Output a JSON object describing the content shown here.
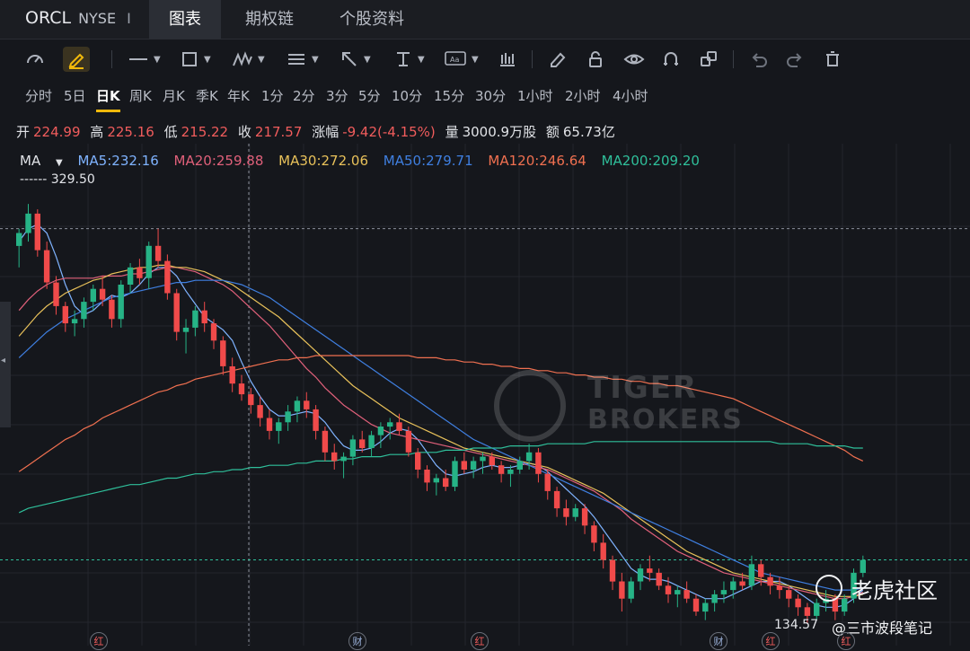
{
  "header": {
    "symbol": "ORCL",
    "exchange": "NYSE",
    "separator": "I",
    "tabs": [
      "图表",
      "期权链",
      "个股资料"
    ]
  },
  "toolbar": {
    "icons": [
      "gauge-icon",
      "pencil-highlight-icon",
      "line-icon",
      "rectangle-icon",
      "wave-icon",
      "text-lines-icon",
      "arrow-icon",
      "text-cursor-icon",
      "aa-label-icon",
      "bars-icon",
      "eraser-icon",
      "lock-icon",
      "eye-icon",
      "magnet-icon",
      "layers-icon",
      "undo-icon",
      "redo-icon",
      "trash-icon"
    ]
  },
  "periods": [
    "分时",
    "5日",
    "日K",
    "周K",
    "月K",
    "季K",
    "年K",
    "1分",
    "2分",
    "3分",
    "5分",
    "10分",
    "15分",
    "30分",
    "1小时",
    "2小时",
    "4小时"
  ],
  "active_period": "日K",
  "quote": {
    "open_label": "开",
    "open": "224.99",
    "high_label": "高",
    "high": "225.16",
    "low_label": "低",
    "low": "215.22",
    "close_label": "收",
    "close": "217.57",
    "change_label": "涨幅",
    "change": "-9.42(-4.15%)",
    "volume_label": "量",
    "volume": "3000.9万股",
    "amount_label": "额",
    "amount": "65.73亿"
  },
  "ma_legend": {
    "title": "MA",
    "items": [
      {
        "text": "MA5:232.16",
        "color": "#7fb3ff"
      },
      {
        "text": "MA20:259.88",
        "color": "#e0607a"
      },
      {
        "text": "MA30:272.06",
        "color": "#e8c15a"
      },
      {
        "text": "MA50:279.71",
        "color": "#3f7fe0"
      },
      {
        "text": "MA120:246.64",
        "color": "#f07050"
      },
      {
        "text": "MA200:209.20",
        "color": "#2fbf9a"
      }
    ]
  },
  "chart_data": {
    "type": "candlestick",
    "high_marker": "329.50",
    "low_marker": "134.57",
    "ylim": [
      130,
      345
    ],
    "up_color": "#26b386",
    "down_color": "#f04a4a",
    "candles": [
      [
        310,
        318,
        300,
        316
      ],
      [
        316,
        329.5,
        312,
        325
      ],
      [
        325,
        327,
        305,
        308
      ],
      [
        308,
        312,
        290,
        293
      ],
      [
        293,
        296,
        278,
        282
      ],
      [
        282,
        284,
        270,
        274
      ],
      [
        274,
        280,
        268,
        276
      ],
      [
        276,
        286,
        272,
        284
      ],
      [
        284,
        292,
        280,
        290
      ],
      [
        290,
        296,
        282,
        285
      ],
      [
        285,
        287,
        272,
        276
      ],
      [
        276,
        294,
        272,
        292
      ],
      [
        292,
        302,
        288,
        300
      ],
      [
        300,
        304,
        292,
        295
      ],
      [
        295,
        312,
        290,
        310
      ],
      [
        310,
        318,
        300,
        303
      ],
      [
        303,
        306,
        285,
        288
      ],
      [
        288,
        290,
        266,
        270
      ],
      [
        270,
        276,
        260,
        272
      ],
      [
        272,
        282,
        268,
        280
      ],
      [
        280,
        284,
        270,
        274
      ],
      [
        274,
        276,
        262,
        266
      ],
      [
        266,
        268,
        250,
        254
      ],
      [
        254,
        258,
        242,
        246
      ],
      [
        246,
        250,
        238,
        241
      ],
      [
        241,
        244,
        232,
        236
      ],
      [
        236,
        240,
        226,
        230
      ],
      [
        230,
        234,
        220,
        224
      ],
      [
        224,
        230,
        218,
        228
      ],
      [
        228,
        236,
        224,
        233
      ],
      [
        233,
        240,
        228,
        238
      ],
      [
        238,
        242,
        230,
        234
      ],
      [
        234,
        236,
        220,
        224
      ],
      [
        224,
        226,
        210,
        214
      ],
      [
        214,
        218,
        206,
        210
      ],
      [
        210,
        214,
        202,
        212
      ],
      [
        212,
        222,
        208,
        220
      ],
      [
        220,
        224,
        214,
        216
      ],
      [
        216,
        224,
        212,
        222
      ],
      [
        222,
        228,
        216,
        226
      ],
      [
        226,
        230,
        220,
        228
      ],
      [
        228,
        232,
        222,
        224
      ],
      [
        224,
        226,
        212,
        214
      ],
      [
        214,
        216,
        202,
        206
      ],
      [
        206,
        208,
        196,
        200
      ],
      [
        200,
        204,
        194,
        202
      ],
      [
        202,
        206,
        196,
        198
      ],
      [
        198,
        212,
        196,
        210
      ],
      [
        210,
        214,
        204,
        206
      ],
      [
        206,
        212,
        202,
        210
      ],
      [
        210,
        214,
        204,
        212
      ],
      [
        212,
        214,
        206,
        208
      ],
      [
        208,
        210,
        200,
        204
      ],
      [
        204,
        208,
        198,
        206
      ],
      [
        206,
        212,
        204,
        210
      ],
      [
        210,
        218,
        206,
        214
      ],
      [
        214,
        216,
        200,
        204
      ],
      [
        204,
        206,
        192,
        196
      ],
      [
        196,
        198,
        184,
        188
      ],
      [
        188,
        192,
        180,
        184
      ],
      [
        184,
        190,
        182,
        188
      ],
      [
        188,
        190,
        176,
        180
      ],
      [
        180,
        182,
        168,
        172
      ],
      [
        172,
        176,
        160,
        164
      ],
      [
        164,
        166,
        150,
        154
      ],
      [
        154,
        158,
        140,
        146
      ],
      [
        146,
        156,
        144,
        154
      ],
      [
        154,
        162,
        150,
        160
      ],
      [
        160,
        166,
        154,
        158
      ],
      [
        158,
        160,
        150,
        152
      ],
      [
        152,
        156,
        144,
        148
      ],
      [
        148,
        152,
        142,
        150
      ],
      [
        150,
        154,
        144,
        146
      ],
      [
        146,
        148,
        138,
        140
      ],
      [
        140,
        146,
        136,
        144
      ],
      [
        144,
        150,
        140,
        148
      ],
      [
        148,
        154,
        144,
        150
      ],
      [
        150,
        156,
        146,
        154
      ],
      [
        154,
        158,
        150,
        152
      ],
      [
        152,
        166,
        150,
        162
      ],
      [
        162,
        164,
        152,
        156
      ],
      [
        156,
        158,
        148,
        152
      ],
      [
        152,
        156,
        146,
        150
      ],
      [
        150,
        152,
        142,
        146
      ],
      [
        146,
        148,
        138,
        142
      ],
      [
        142,
        144,
        134.57,
        138
      ],
      [
        138,
        146,
        136,
        144
      ],
      [
        144,
        150,
        140,
        146
      ],
      [
        146,
        148,
        136,
        140
      ],
      [
        140,
        148,
        138,
        146
      ],
      [
        146,
        160,
        144,
        158
      ],
      [
        158,
        166,
        156,
        164
      ]
    ],
    "series": [
      {
        "name": "MA5",
        "color": "#7fb3ff",
        "values": [
          312,
          318,
          320,
          316,
          305,
          292,
          282,
          278,
          280,
          284,
          287,
          286,
          288,
          292,
          297,
          300,
          300,
          296,
          289,
          283,
          277,
          274,
          271,
          266,
          256,
          247,
          240,
          234,
          231,
          231,
          232,
          233,
          232,
          228,
          222,
          217,
          215,
          215,
          216,
          219,
          223,
          225,
          224,
          220,
          214,
          208,
          204,
          203,
          204,
          205,
          207,
          208,
          207,
          207,
          208,
          209,
          208,
          205,
          201,
          197,
          193,
          189,
          184,
          178,
          172,
          166,
          160,
          157,
          155,
          155,
          154,
          152,
          150,
          148,
          146,
          146,
          146,
          148,
          150,
          152,
          154,
          154,
          154,
          152,
          149,
          146,
          143,
          142,
          142,
          143,
          146,
          150
        ]
      },
      {
        "name": "MA20",
        "color": "#e0607a",
        "values": [
          280,
          285,
          289,
          292,
          294,
          295,
          295,
          295,
          295,
          296,
          296,
          296,
          297,
          297,
          298,
          299,
          300,
          300,
          299,
          298,
          296,
          294,
          292,
          289,
          285,
          281,
          277,
          273,
          268,
          263,
          258,
          253,
          249,
          244,
          240,
          236,
          233,
          230,
          227,
          225,
          223,
          222,
          221,
          220,
          219,
          218,
          217,
          216,
          215,
          214,
          213,
          212,
          211,
          210,
          209,
          208,
          207,
          206,
          204,
          202,
          200,
          198,
          196,
          193,
          190,
          187,
          183,
          180,
          177,
          174,
          171,
          168,
          166,
          164,
          162,
          160,
          158,
          157,
          156,
          155,
          154,
          153,
          152,
          151,
          150,
          149,
          148,
          147,
          146,
          146,
          147,
          149
        ]
      },
      {
        "name": "MA30",
        "color": "#e8c15a",
        "values": [
          268,
          273,
          278,
          282,
          285,
          288,
          290,
          292,
          294,
          295,
          297,
          298,
          299,
          300,
          300,
          301,
          301,
          300,
          300,
          299,
          298,
          296,
          294,
          292,
          289,
          286,
          283,
          280,
          277,
          273,
          269,
          265,
          261,
          257,
          253,
          249,
          245,
          242,
          239,
          236,
          233,
          230,
          228,
          226,
          224,
          222,
          220,
          218,
          216,
          215,
          214,
          213,
          212,
          211,
          210,
          209,
          208,
          207,
          205,
          203,
          201,
          199,
          197,
          195,
          192,
          189,
          186,
          183,
          180,
          177,
          174,
          171,
          168,
          166,
          164,
          162,
          160,
          158,
          157,
          156,
          155,
          154,
          153,
          152,
          151,
          150,
          149,
          148,
          147,
          147,
          147,
          148
        ]
      },
      {
        "name": "MA50",
        "color": "#3f7fe0",
        "values": [
          258,
          262,
          266,
          270,
          273,
          276,
          278,
          280,
          282,
          284,
          286,
          287,
          288,
          289,
          290,
          291,
          292,
          293,
          293,
          294,
          294,
          294,
          294,
          293,
          292,
          290,
          288,
          286,
          283,
          280,
          277,
          274,
          271,
          268,
          265,
          262,
          259,
          256,
          253,
          250,
          247,
          244,
          241,
          238,
          235,
          232,
          229,
          226,
          223,
          220,
          218,
          216,
          214,
          212,
          210,
          208,
          206,
          204,
          202,
          200,
          198,
          196,
          194,
          192,
          190,
          188,
          186,
          184,
          182,
          180,
          178,
          176,
          174,
          172,
          170,
          168,
          166,
          164,
          162,
          160,
          158,
          157,
          156,
          155,
          154,
          153,
          152,
          151,
          150,
          150,
          150,
          151
        ]
      },
      {
        "name": "MA120",
        "color": "#f07050",
        "values": [
          205,
          208,
          211,
          214,
          217,
          220,
          222,
          225,
          227,
          230,
          232,
          234,
          236,
          238,
          240,
          242,
          243,
          245,
          246,
          248,
          249,
          250,
          251,
          252,
          253,
          254,
          255,
          256,
          257,
          257,
          258,
          258,
          259,
          259,
          259,
          259,
          259,
          259,
          259,
          259,
          259,
          259,
          259,
          258,
          258,
          258,
          257,
          257,
          256,
          256,
          255,
          255,
          254,
          254,
          253,
          253,
          252,
          252,
          251,
          251,
          250,
          250,
          249,
          249,
          248,
          248,
          247,
          247,
          246,
          246,
          245,
          245,
          244,
          243,
          242,
          241,
          240,
          239,
          237,
          235,
          233,
          231,
          229,
          227,
          225,
          223,
          221,
          219,
          217,
          215,
          212,
          210
        ]
      },
      {
        "name": "MA200",
        "color": "#2fbf9a",
        "values": [
          186,
          188,
          189,
          190,
          191,
          192,
          193,
          194,
          195,
          196,
          197,
          198,
          199,
          199,
          200,
          201,
          202,
          202,
          203,
          204,
          204,
          205,
          205,
          206,
          206,
          207,
          207,
          208,
          208,
          208,
          209,
          209,
          210,
          210,
          210,
          211,
          211,
          212,
          212,
          212,
          213,
          213,
          213,
          214,
          214,
          214,
          215,
          215,
          215,
          216,
          216,
          216,
          216,
          217,
          217,
          217,
          217,
          218,
          218,
          218,
          218,
          218,
          219,
          219,
          219,
          219,
          219,
          219,
          219,
          219,
          219,
          219,
          219,
          219,
          219,
          219,
          219,
          219,
          219,
          219,
          219,
          219,
          218,
          218,
          218,
          218,
          217,
          217,
          217,
          217,
          216,
          216
        ]
      }
    ]
  },
  "watermark": {
    "line1": "TIGER",
    "line2": "BROKERS"
  },
  "brand": {
    "name": "老虎社区",
    "handle": "@三市波段笔记"
  },
  "event_markers": [
    "红",
    "财",
    "红",
    "财",
    "红",
    "红"
  ]
}
